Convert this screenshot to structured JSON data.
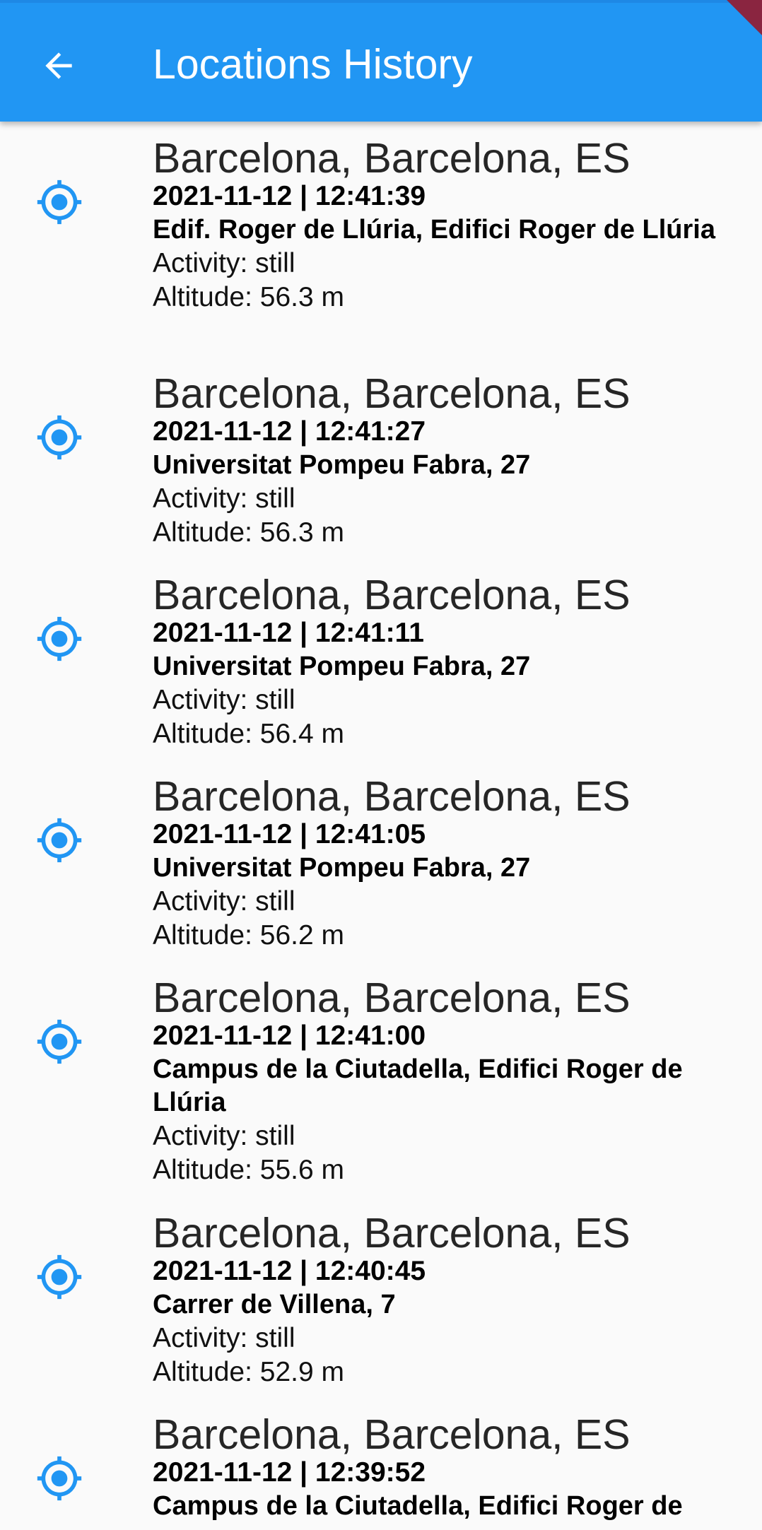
{
  "app_bar": {
    "title": "Locations History",
    "back_icon": "arrow-back-icon",
    "color": "#2196f3"
  },
  "accent_color": "#2196f3",
  "locations": [
    {
      "city": "Barcelona, Barcelona, ES",
      "datetime": "2021-11-12 | 12:41:39",
      "address": "Edif. Roger de Llúria, Edifici Roger de Llúria",
      "activity": "Activity: still",
      "altitude": "Altitude: 56.3 m",
      "icon": "gps-fixed-icon"
    },
    {
      "city": "Barcelona, Barcelona, ES",
      "datetime": "2021-11-12 | 12:41:27",
      "address": "Universitat Pompeu Fabra, 27",
      "activity": "Activity: still",
      "altitude": "Altitude: 56.3 m",
      "icon": "gps-fixed-icon"
    },
    {
      "city": "Barcelona, Barcelona, ES",
      "datetime": "2021-11-12 | 12:41:11",
      "address": "Universitat Pompeu Fabra, 27",
      "activity": "Activity: still",
      "altitude": "Altitude: 56.4 m",
      "icon": "gps-fixed-icon"
    },
    {
      "city": "Barcelona, Barcelona, ES",
      "datetime": "2021-11-12 | 12:41:05",
      "address": "Universitat Pompeu Fabra, 27",
      "activity": "Activity: still",
      "altitude": "Altitude: 56.2 m",
      "icon": "gps-fixed-icon"
    },
    {
      "city": "Barcelona, Barcelona, ES",
      "datetime": "2021-11-12 | 12:41:00",
      "address": "Campus de la Ciutadella, Edifici Roger de Llúria",
      "activity": "Activity: still",
      "altitude": "Altitude: 55.6 m",
      "icon": "gps-fixed-icon"
    },
    {
      "city": "Barcelona, Barcelona, ES",
      "datetime": "2021-11-12 | 12:40:45",
      "address": "Carrer de Villena, 7",
      "activity": "Activity: still",
      "altitude": "Altitude: 52.9 m",
      "icon": "gps-fixed-icon"
    },
    {
      "city": "Barcelona, Barcelona, ES",
      "datetime": "2021-11-12 | 12:39:52",
      "address": "Campus de la Ciutadella, Edifici Roger de",
      "activity": "",
      "altitude": "",
      "icon": "gps-fixed-icon"
    }
  ]
}
